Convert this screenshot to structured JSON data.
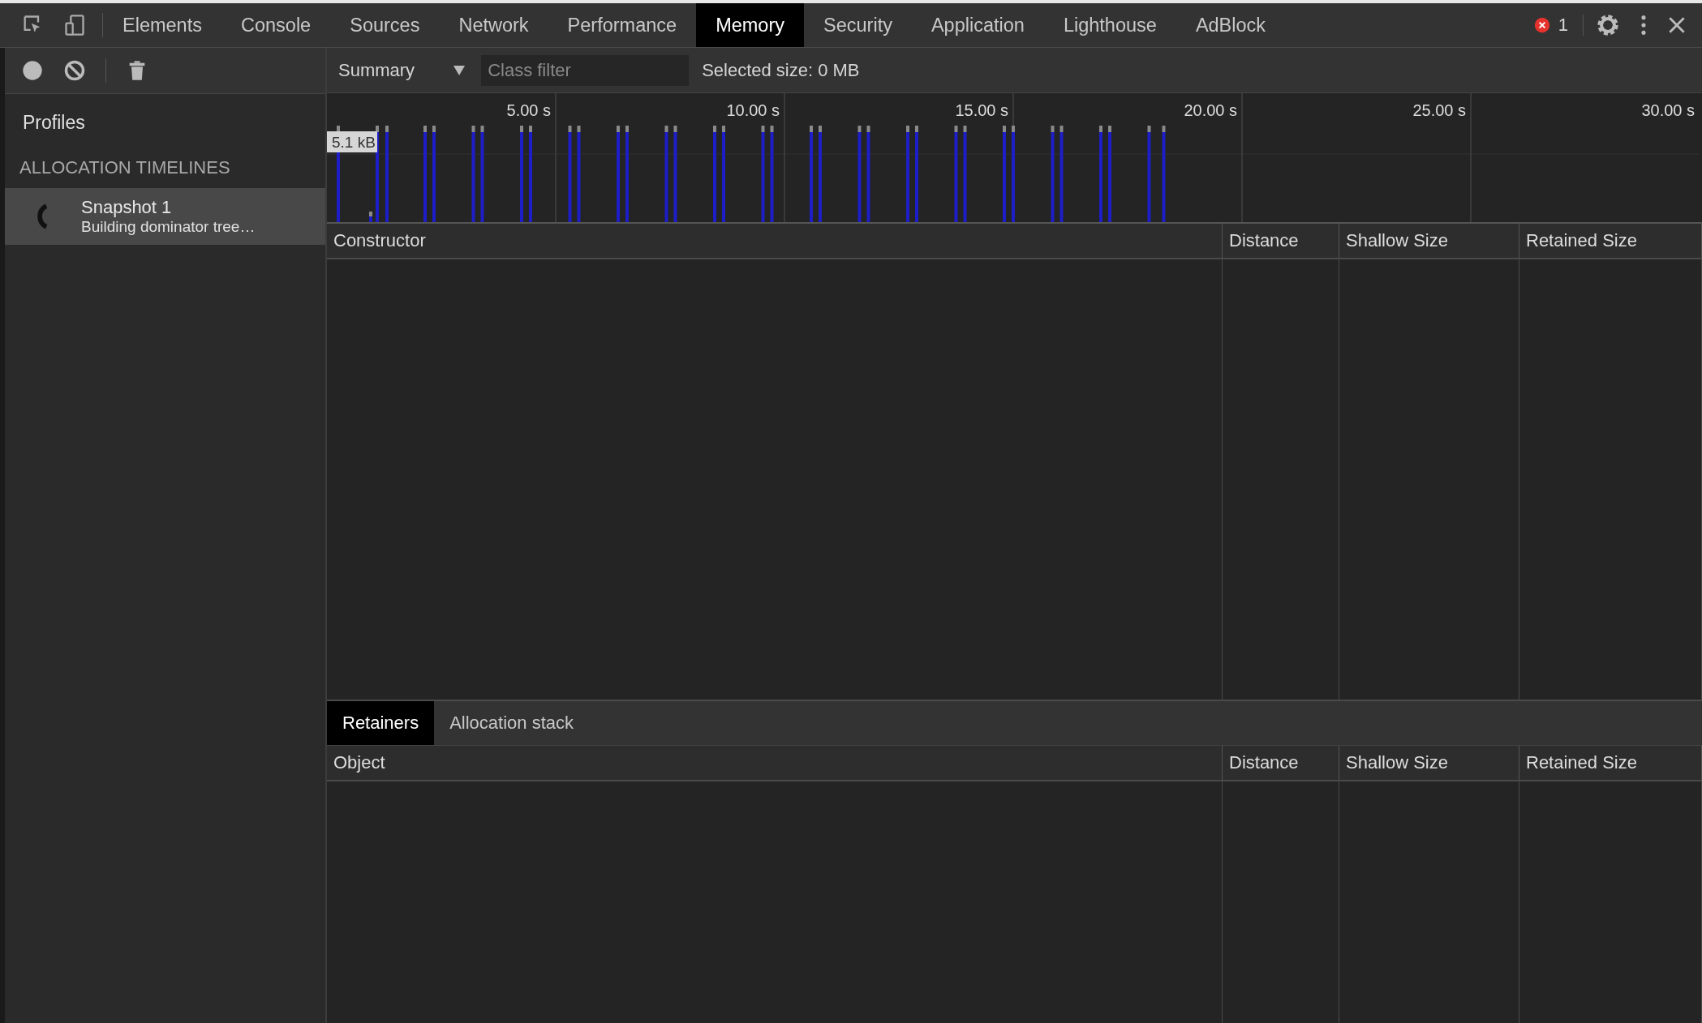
{
  "toolbar_tabs": [
    {
      "label": "Elements",
      "selected": false
    },
    {
      "label": "Console",
      "selected": false
    },
    {
      "label": "Sources",
      "selected": false
    },
    {
      "label": "Network",
      "selected": false
    },
    {
      "label": "Performance",
      "selected": false
    },
    {
      "label": "Memory",
      "selected": true
    },
    {
      "label": "Security",
      "selected": false
    },
    {
      "label": "Application",
      "selected": false
    },
    {
      "label": "Lighthouse",
      "selected": false
    },
    {
      "label": "AdBlock",
      "selected": false
    }
  ],
  "error_count": "1",
  "view_select": {
    "value": "Summary"
  },
  "class_filter": {
    "placeholder": "Class filter"
  },
  "selected_size": "Selected size: 0 MB",
  "sidebar": {
    "title": "Profiles",
    "section": "ALLOCATION TIMELINES",
    "items": [
      {
        "title": "Snapshot 1",
        "status": "Building dominator tree…",
        "selected": true
      }
    ]
  },
  "timeline": {
    "ticks": [
      "5.00 s",
      "10.00 s",
      "15.00 s",
      "20.00 s",
      "25.00 s",
      "30.00 s"
    ],
    "size_label": "5.1 kB"
  },
  "main_table": {
    "columns": [
      "Constructor",
      "Distance",
      "Shallow Size",
      "Retained Size"
    ]
  },
  "detail_tabs": [
    {
      "label": "Retainers",
      "selected": true
    },
    {
      "label": "Allocation stack",
      "selected": false
    }
  ],
  "detail_table": {
    "columns": [
      "Object",
      "Distance",
      "Shallow Size",
      "Retained Size"
    ]
  }
}
